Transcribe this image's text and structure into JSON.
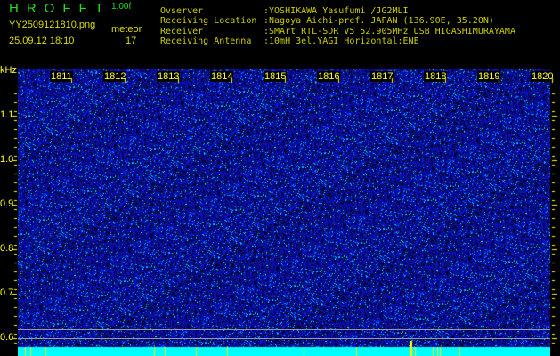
{
  "header": {
    "app_title": "HROFFT",
    "version": "1.00f",
    "filename": "YY2509121810.png",
    "datetime": "25.09.12 18:10",
    "meteor_label": "meteor",
    "meteor_count": "17"
  },
  "info": [
    {
      "label": "Ovserver",
      "value": ":YOSHIKAWA Yasufumi /JG2MLI"
    },
    {
      "label": "Receiving Location",
      "value": ":Nagoya Aichi-pref. JAPAN (136.90E, 35.20N)"
    },
    {
      "label": "Receiver",
      "value": ":SMArt RTL-SDR V5 52.905MHz USB HIGASHIMURAYAMA"
    },
    {
      "label": "Receiving Antenna",
      "value": ":10mH 3el.YAGI Horizontal:ENE"
    }
  ],
  "axis": {
    "unit": "kHz",
    "y_labels": [
      "1.1",
      "1.0",
      "0.9",
      "0.8",
      "0.7",
      "0.6"
    ],
    "minute_labels": [
      "1811",
      "1812",
      "1813",
      "1814",
      "1815",
      "1816",
      "1817",
      "1818",
      "1819",
      "1820"
    ]
  },
  "colors": {
    "text": "#dddd00",
    "title": "#22dd22",
    "baseline": "#00ffff",
    "bg": "#000000"
  }
}
